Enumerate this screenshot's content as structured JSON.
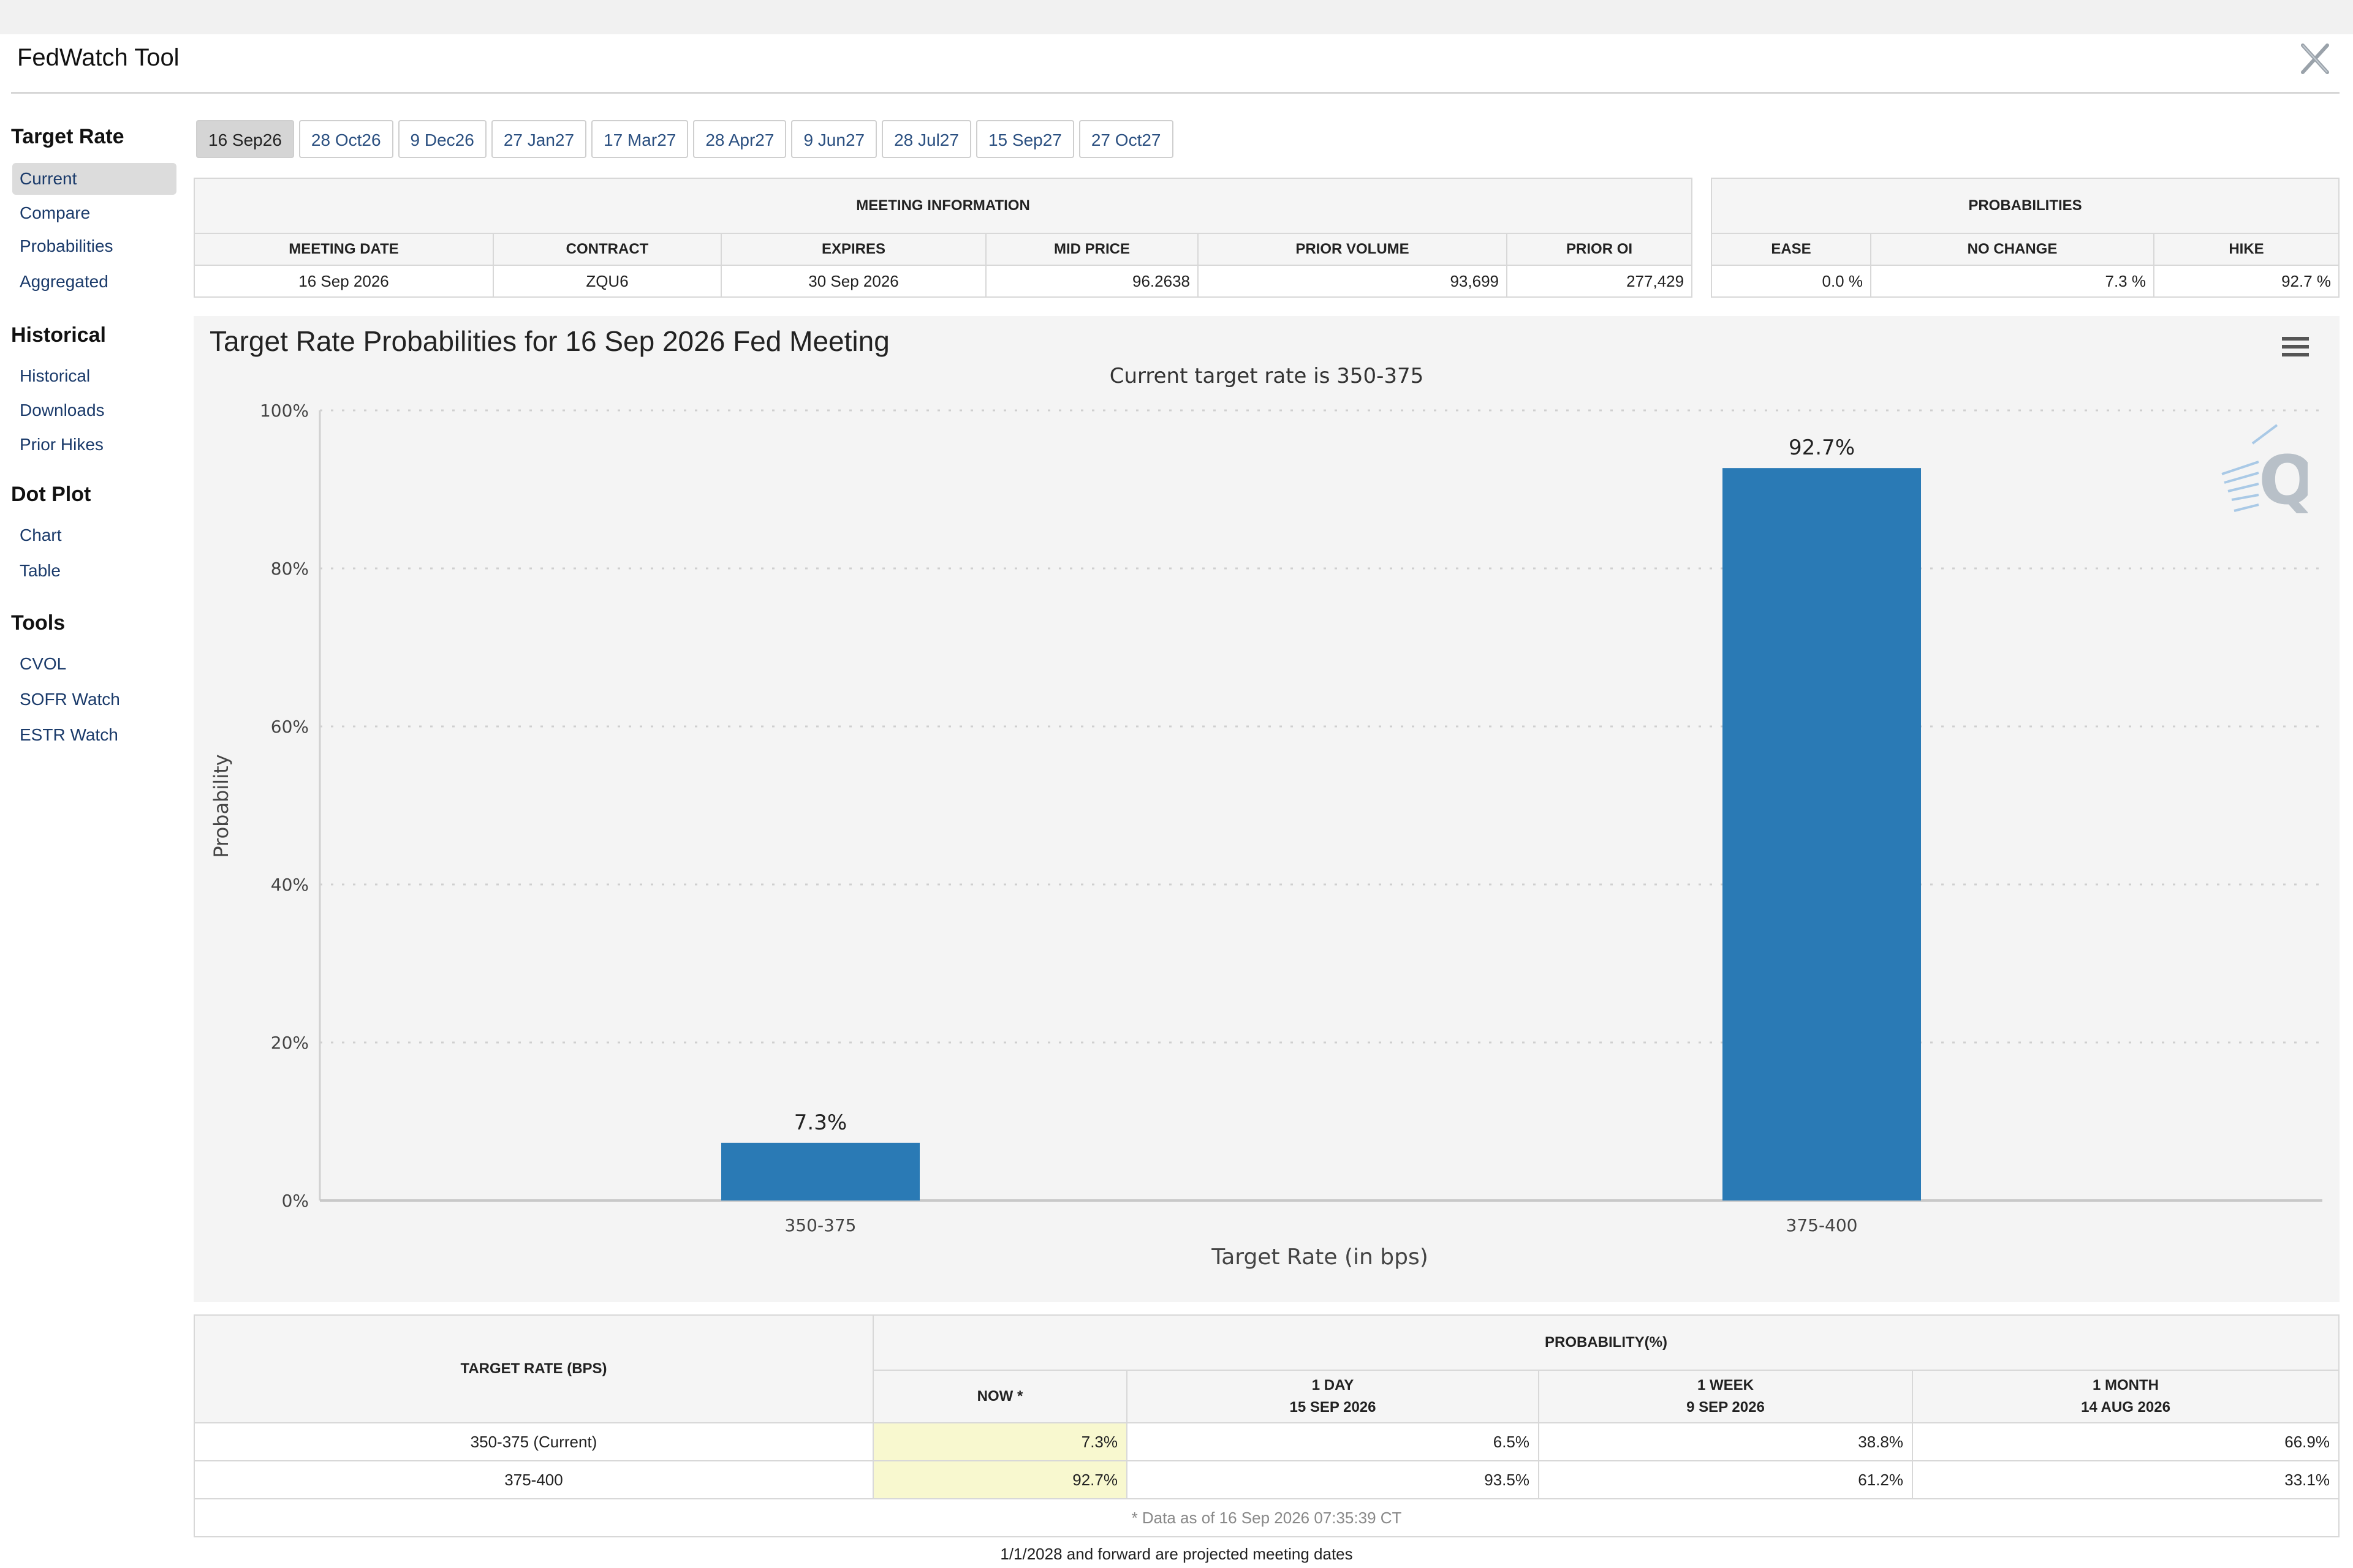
{
  "app": {
    "title": "FedWatch Tool"
  },
  "sidebar": {
    "sections": [
      {
        "heading": "Target Rate",
        "items": [
          "Current",
          "Compare",
          "Probabilities",
          "Aggregated"
        ]
      },
      {
        "heading": "Historical",
        "items": [
          "Historical",
          "Downloads",
          "Prior Hikes"
        ]
      },
      {
        "heading": "Dot Plot",
        "items": [
          "Chart",
          "Table"
        ]
      },
      {
        "heading": "Tools",
        "items": [
          "CVOL",
          "SOFR Watch",
          "ESTR Watch"
        ]
      }
    ],
    "active_item": "Current"
  },
  "meeting_tabs": [
    "16 Sep26",
    "28 Oct26",
    "9 Dec26",
    "27 Jan27",
    "17 Mar27",
    "28 Apr27",
    "9 Jun27",
    "28 Jul27",
    "15 Sep27",
    "27 Oct27"
  ],
  "active_tab": "16 Sep26",
  "meeting_info": {
    "heading": "MEETING INFORMATION",
    "columns": [
      "MEETING DATE",
      "CONTRACT",
      "EXPIRES",
      "MID PRICE",
      "PRIOR VOLUME",
      "PRIOR OI"
    ],
    "values": [
      "16 Sep 2026",
      "ZQU6",
      "30 Sep 2026",
      "96.2638",
      "93,699",
      "277,429"
    ]
  },
  "probabilities": {
    "heading": "PROBABILITIES",
    "columns": [
      "EASE",
      "NO CHANGE",
      "HIKE"
    ],
    "values": [
      "0.0 %",
      "7.3 %",
      "92.7 %"
    ]
  },
  "chart": {
    "title": "Target Rate Probabilities for 16 Sep 2026 Fed Meeting",
    "subtitle": "Current target rate is 350-375"
  },
  "chart_data": {
    "type": "bar",
    "categories": [
      "350-375",
      "375-400"
    ],
    "values": [
      7.3,
      92.7
    ],
    "data_labels": [
      "7.3%",
      "92.7%"
    ],
    "title": "Target Rate Probabilities for 16 Sep 2026 Fed Meeting",
    "subtitle": "Current target rate is 350-375",
    "xlabel": "Target Rate (in bps)",
    "ylabel": "Probability",
    "ylim": [
      0,
      100
    ],
    "yticks": [
      "0%",
      "20%",
      "40%",
      "60%",
      "80%",
      "100%"
    ],
    "grid": true,
    "bar_color": "#2a7ab5"
  },
  "prob_table": {
    "rate_header": "TARGET RATE (BPS)",
    "prob_header": "PROBABILITY(%)",
    "columns": [
      {
        "line1": "NOW *",
        "line2": ""
      },
      {
        "line1": "1 DAY",
        "line2": "15 SEP 2026"
      },
      {
        "line1": "1 WEEK",
        "line2": "9 SEP 2026"
      },
      {
        "line1": "1 MONTH",
        "line2": "14 AUG 2026"
      }
    ],
    "rows": [
      {
        "rate": "350-375 (Current)",
        "values": [
          "7.3%",
          "6.5%",
          "38.8%",
          "66.9%"
        ]
      },
      {
        "rate": "375-400",
        "values": [
          "92.7%",
          "93.5%",
          "61.2%",
          "33.1%"
        ]
      }
    ],
    "note": "* Data as of 16 Sep 2026 07:35:39 CT"
  },
  "footer": {
    "text": "1/1/2028 and forward are projected meeting dates"
  },
  "colors": {
    "accent": "#2a7ab5",
    "highlight": "#f8f8cf",
    "link": "#2a4f80"
  },
  "icons": {
    "close": "close-icon",
    "menu": "menu-icon",
    "watermark": "logo-icon"
  }
}
